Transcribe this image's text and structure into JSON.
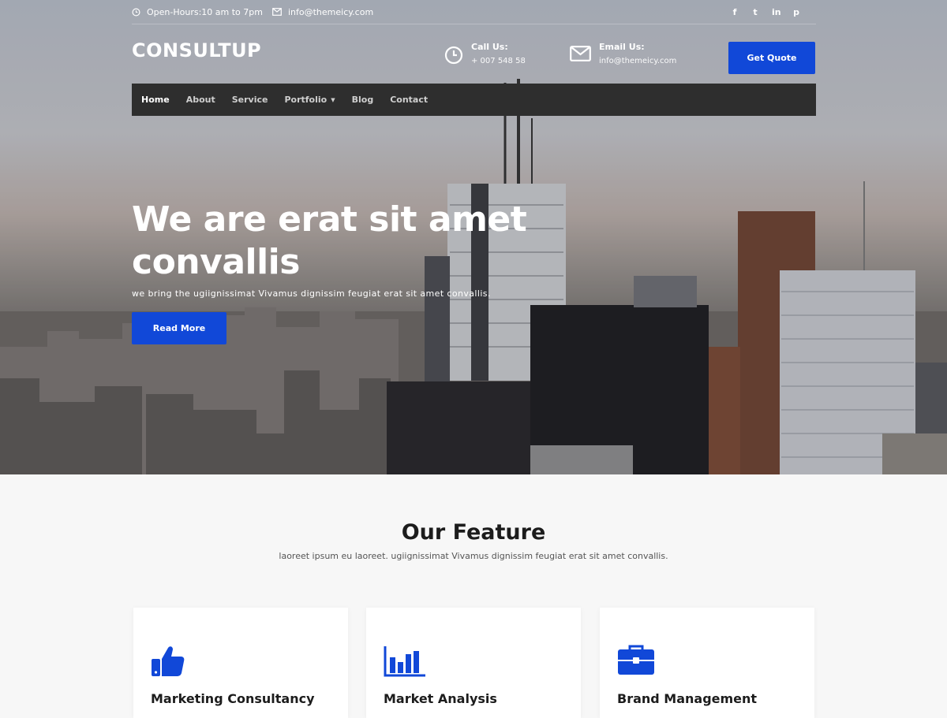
{
  "topbar": {
    "hours": "Open-Hours:10 am to 7pm",
    "email": "info@themeicy.com",
    "social": [
      {
        "name": "facebook-icon",
        "glyph": "f"
      },
      {
        "name": "twitter-icon",
        "glyph": "t"
      },
      {
        "name": "linkedin-icon",
        "glyph": "in"
      },
      {
        "name": "pinterest-icon",
        "glyph": "p"
      }
    ]
  },
  "header": {
    "logo": "CONSULTUP",
    "call_title": "Call Us:",
    "call_value": "+ 007 548 58",
    "email_title": "Email Us:",
    "email_value": "info@themeicy.com",
    "quote_label": "Get Quote"
  },
  "nav": {
    "items": [
      "Home",
      "About",
      "Service",
      "Portfolio",
      "Blog",
      "Contact"
    ]
  },
  "hero": {
    "title_line1": "We are erat sit amet",
    "title_line2": "convallis",
    "subtitle": "we bring the ugiignissimat Vivamus dignissim feugiat erat sit amet convallis.",
    "button": "Read More"
  },
  "features": {
    "title": "Our Feature",
    "subtitle": "laoreet ipsum eu laoreet. ugiignissimat Vivamus dignissim feugiat erat sit amet convallis.",
    "cards": [
      {
        "title": "Marketing Consultancy",
        "icon": "thumbs-up-icon"
      },
      {
        "title": "Market Analysis",
        "icon": "bar-chart-icon"
      },
      {
        "title": "Brand Management",
        "icon": "briefcase-icon"
      }
    ]
  },
  "colors": {
    "accent": "#1148d8",
    "nav_bg": "#2e2e2e",
    "section_bg": "#f7f7f7"
  }
}
